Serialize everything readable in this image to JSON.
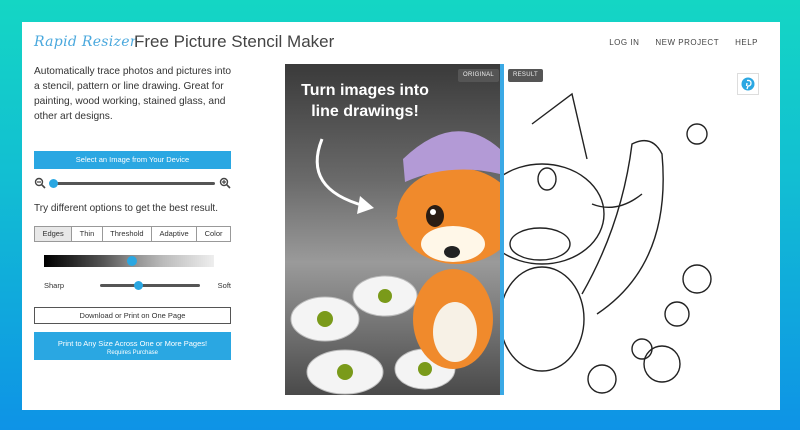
{
  "header": {
    "logo": "Rapid Resizer",
    "title": "Free Picture Stencil Maker",
    "nav": [
      "LOG IN",
      "NEW PROJECT",
      "HELP"
    ]
  },
  "left_panel": {
    "intro": "Automatically trace photos and pictures into a stencil, pattern or line drawing. Great for painting, wood working, stained glass, and other art designs.",
    "select_button": "Select an Image from Your Device",
    "zoom_level": 0.02,
    "tip": "Try different options to get the best result.",
    "tabs": [
      "Edges",
      "Thin",
      "Threshold",
      "Adaptive",
      "Color"
    ],
    "active_tab": "Edges",
    "threshold_level": 0.52,
    "sharp_label": "Sharp",
    "soft_label": "Soft",
    "sharpness_level": 0.38,
    "download_button": "Download or Print on One Page",
    "print_button": "Print to Any Size Across One or More Pages!",
    "print_button_sub": "Requires Purchase"
  },
  "preview": {
    "overlay_text": "Turn images into line drawings!",
    "badge_original": "ORIGINAL",
    "badge_result": "RESULT"
  },
  "colors": {
    "accent": "#2aa7e2",
    "bg_top": "#14d6c4",
    "bg_bottom": "#0e93e6"
  }
}
